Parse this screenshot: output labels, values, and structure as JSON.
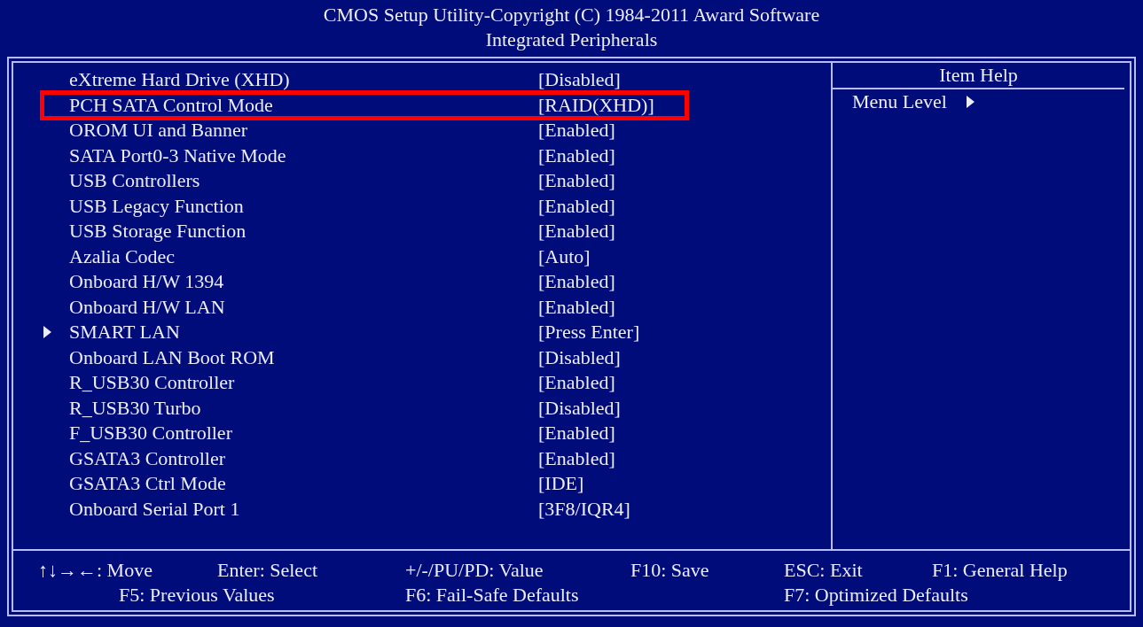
{
  "title": [
    "CMOS Setup Utility-Copyright (C) 1984-2011 Award Software",
    "Integrated Peripherals"
  ],
  "settings": [
    {
      "label": "eXtreme Hard Drive (XHD)",
      "value": "[Disabled]",
      "submenu": false,
      "marked": false
    },
    {
      "label": "PCH SATA Control Mode",
      "value": "[RAID(XHD)]",
      "submenu": false,
      "marked": true
    },
    {
      "label": "OROM UI and Banner",
      "value": "[Enabled]",
      "submenu": false,
      "marked": false
    },
    {
      "label": "SATA Port0-3 Native Mode",
      "value": "[Enabled]",
      "submenu": false,
      "marked": false
    },
    {
      "label": "USB Controllers",
      "value": "[Enabled]",
      "submenu": false,
      "marked": false
    },
    {
      "label": "USB Legacy Function",
      "value": "[Enabled]",
      "submenu": false,
      "marked": false
    },
    {
      "label": "USB Storage Function",
      "value": "[Enabled]",
      "submenu": false,
      "marked": false
    },
    {
      "label": "Azalia Codec",
      "value": "[Auto]",
      "submenu": false,
      "marked": false
    },
    {
      "label": "Onboard H/W 1394",
      "value": "[Enabled]",
      "submenu": false,
      "marked": false
    },
    {
      "label": "Onboard H/W LAN",
      "value": "[Enabled]",
      "submenu": false,
      "marked": false
    },
    {
      "label": "SMART LAN",
      "value": "[Press Enter]",
      "submenu": true,
      "marked": false
    },
    {
      "label": "Onboard LAN Boot ROM",
      "value": "[Disabled]",
      "submenu": false,
      "marked": false
    },
    {
      "label": "R_USB30 Controller",
      "value": "[Enabled]",
      "submenu": false,
      "marked": false
    },
    {
      "label": "R_USB30 Turbo",
      "value": "[Disabled]",
      "submenu": false,
      "marked": false
    },
    {
      "label": "F_USB30 Controller",
      "value": "[Enabled]",
      "submenu": false,
      "marked": false
    },
    {
      "label": "GSATA3 Controller",
      "value": "[Enabled]",
      "submenu": false,
      "marked": false
    },
    {
      "label": "GSATA3 Ctrl Mode",
      "value": "[IDE]",
      "submenu": false,
      "marked": false
    },
    {
      "label": "Onboard Serial Port 1",
      "value": "[3F8/IQR4]",
      "submenu": false,
      "marked": false
    }
  ],
  "item_help": {
    "title": "Item Help",
    "menu_level": "Menu Level"
  },
  "footer": [
    [
      "↑↓→←: Move",
      "Enter: Select",
      "+/-/PU/PD: Value",
      "F10: Save",
      "ESC: Exit",
      "F1: General Help"
    ],
    [
      "F5: Previous Values",
      "F6: Fail-Safe Defaults",
      "F7: Optimized Defaults"
    ]
  ]
}
